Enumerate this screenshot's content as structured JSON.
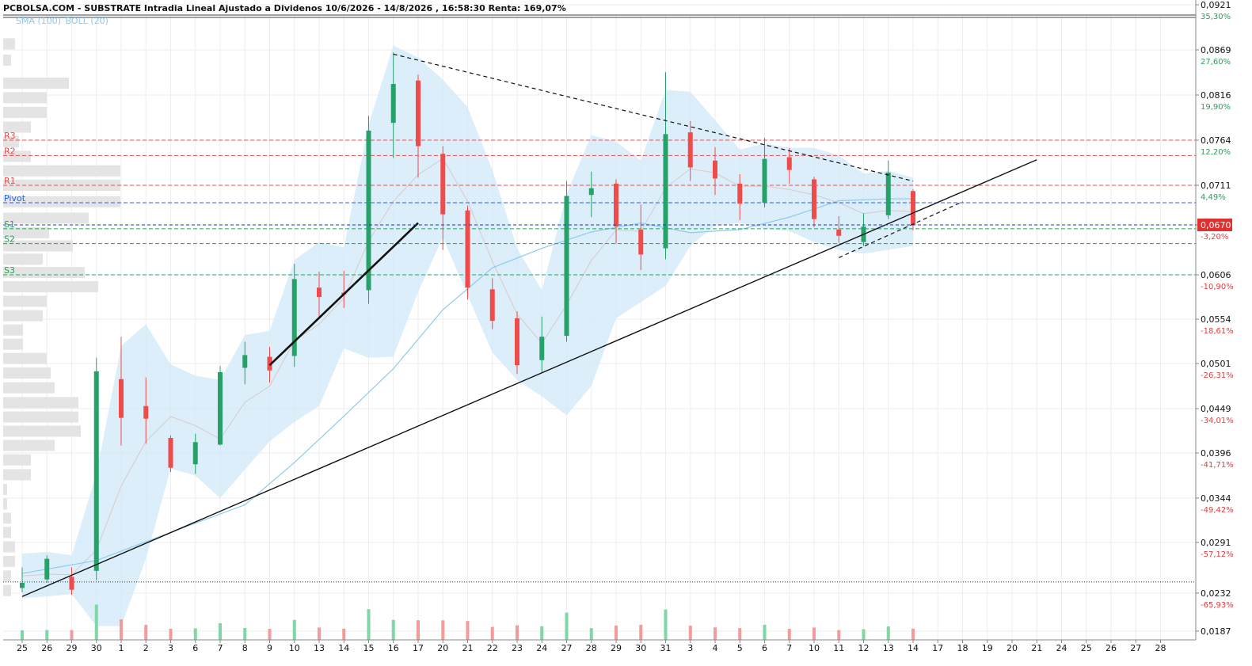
{
  "header": {
    "title": "PCBOLSA.COM - SUBSTRATE Intradia Lineal Ajustado a Dividenos 10/6/2026 - 14/8/2026 , 16:58:30 Renta: 169,07%",
    "indicators": [
      "SMA (100)",
      "BOLL (20)"
    ]
  },
  "chart_data": {
    "type": "candlestick",
    "title": "PCBOLSA.COM - SUBSTRATE Intradia Lineal Ajustado a Dividenos 10/6/2026 - 14/8/2026 , 16:58:30 Renta: 169,07%",
    "x_tick_labels": [
      "25",
      "26",
      "29",
      "30",
      "1",
      "2",
      "3",
      "6",
      "7",
      "8",
      "9",
      "10",
      "13",
      "14",
      "15",
      "16",
      "17",
      "20",
      "21",
      "22",
      "23",
      "24",
      "27",
      "28",
      "29",
      "30",
      "31",
      "3",
      "4",
      "5",
      "6",
      "7",
      "10",
      "11",
      "12",
      "13",
      "14",
      "17",
      "18",
      "19",
      "20",
      "21",
      "24",
      "25",
      "26",
      "27",
      "28"
    ],
    "y_axis": {
      "position": "right",
      "range": [
        0.0187,
        0.0921
      ],
      "ticks": [
        {
          "price": "0,0921",
          "pct": "35,30%",
          "pct_color": "#2e9e5b"
        },
        {
          "price": "0,0869",
          "pct": "27,60%",
          "pct_color": "#2e9e5b"
        },
        {
          "price": "0,0816",
          "pct": "19,90%",
          "pct_color": "#2e9e5b"
        },
        {
          "price": "0,0764",
          "pct": "12,20%",
          "pct_color": "#2e9e5b"
        },
        {
          "price": "0,0711",
          "pct": "4,49%",
          "pct_color": "#2e9e5b"
        },
        {
          "price": "0,0670",
          "pct": "-3,20%",
          "pct_color": "#e04040"
        },
        {
          "price": "0,0606",
          "pct": "-10,90%",
          "pct_color": "#e04040"
        },
        {
          "price": "0,0554",
          "pct": "-18,61%",
          "pct_color": "#e04040"
        },
        {
          "price": "0,0501",
          "pct": "-26,31%",
          "pct_color": "#e04040"
        },
        {
          "price": "0,0449",
          "pct": "-34,01%",
          "pct_color": "#e04040"
        },
        {
          "price": "0,0396",
          "pct": "-41,71%",
          "pct_color": "#e04040"
        },
        {
          "price": "0,0344",
          "pct": "-49,42%",
          "pct_color": "#e04040"
        },
        {
          "price": "0,0291",
          "pct": "-57,12%",
          "pct_color": "#e04040"
        },
        {
          "price": "0,0232",
          "pct": "-65,93%",
          "pct_color": "#e04040"
        },
        {
          "price": "0,0187",
          "pct": "",
          "pct_color": "#e04040"
        }
      ]
    },
    "last_price": {
      "label": "0,0670",
      "value": 0.067,
      "color": "#e03030"
    },
    "pivot_levels": [
      {
        "name": "R3",
        "value": 0.0764,
        "color": "#e05050",
        "style": "dashed"
      },
      {
        "name": "R2",
        "value": 0.0746,
        "color": "#e05050",
        "style": "dashed"
      },
      {
        "name": "R1",
        "value": 0.0711,
        "color": "#e05050",
        "style": "dashed"
      },
      {
        "name": "Pivot",
        "value": 0.0693,
        "color": "#3060d0",
        "style": "dashed"
      },
      {
        "name": "S1",
        "value": 0.0665,
        "color": "#2e9e5b",
        "style": "dashed"
      },
      {
        "name": "S2",
        "value": 0.0646,
        "color": "#2e9e5b",
        "style": "dashed"
      },
      {
        "name": "S3",
        "value": 0.0606,
        "color": "#2e9e5b",
        "style": "dashed"
      }
    ],
    "reference_line": {
      "value": 0.0245,
      "style": "dotted",
      "color": "#333333"
    },
    "grid": true,
    "colors": {
      "up": "#26a269",
      "down": "#f04b4b",
      "bollinger_fill": "#cfe8f8",
      "sma": "#8ccbee",
      "volume_up": "#7fd6a6",
      "volume_down": "#f59a9a"
    },
    "sessions": [
      {
        "date": "25",
        "open": 0.0238,
        "close": 0.0244,
        "high": 0.0262,
        "low": 0.0233
      },
      {
        "date": "26",
        "open": 0.0248,
        "close": 0.0272,
        "high": 0.0276,
        "low": 0.0244
      },
      {
        "date": "29",
        "open": 0.0251,
        "close": 0.0236,
        "high": 0.0262,
        "low": 0.023
      },
      {
        "date": "30",
        "open": 0.0258,
        "close": 0.0492,
        "high": 0.0508,
        "low": 0.0247
      },
      {
        "date": "1",
        "open": 0.0483,
        "close": 0.0438,
        "high": 0.0533,
        "low": 0.0405
      },
      {
        "date": "2",
        "open": 0.0452,
        "close": 0.0437,
        "high": 0.0485,
        "low": 0.0407
      },
      {
        "date": "3",
        "open": 0.0414,
        "close": 0.0379,
        "high": 0.0417,
        "low": 0.0374
      },
      {
        "date": "6",
        "open": 0.0383,
        "close": 0.0409,
        "high": 0.0419,
        "low": 0.0372
      },
      {
        "date": "7",
        "open": 0.0406,
        "close": 0.0491,
        "high": 0.0498,
        "low": 0.0405
      },
      {
        "date": "8",
        "open": 0.0496,
        "close": 0.0511,
        "high": 0.0527,
        "low": 0.0477
      },
      {
        "date": "9",
        "open": 0.0509,
        "close": 0.0493,
        "high": 0.0521,
        "low": 0.0479
      },
      {
        "date": "10",
        "open": 0.051,
        "close": 0.0601,
        "high": 0.062,
        "low": 0.0497
      },
      {
        "date": "13",
        "open": 0.0591,
        "close": 0.058,
        "high": 0.061,
        "low": 0.0556
      },
      {
        "date": "14",
        "open": 0.0585,
        "close": 0.0583,
        "high": 0.0611,
        "low": 0.0567
      },
      {
        "date": "15",
        "open": 0.0588,
        "close": 0.0775,
        "high": 0.0792,
        "low": 0.0572
      },
      {
        "date": "16",
        "open": 0.0784,
        "close": 0.0829,
        "high": 0.0866,
        "low": 0.0743
      },
      {
        "date": "17",
        "open": 0.0833,
        "close": 0.0757,
        "high": 0.084,
        "low": 0.072
      },
      {
        "date": "20",
        "open": 0.0748,
        "close": 0.0681,
        "high": 0.0757,
        "low": 0.0638
      },
      {
        "date": "21",
        "open": 0.0685,
        "close": 0.0591,
        "high": 0.069,
        "low": 0.0577
      },
      {
        "date": "22",
        "open": 0.0589,
        "close": 0.0552,
        "high": 0.0602,
        "low": 0.0542
      },
      {
        "date": "23",
        "open": 0.0555,
        "close": 0.0499,
        "high": 0.0563,
        "low": 0.0489
      },
      {
        "date": "24",
        "open": 0.0505,
        "close": 0.0533,
        "high": 0.0557,
        "low": 0.0491
      },
      {
        "date": "27",
        "open": 0.0534,
        "close": 0.07,
        "high": 0.0716,
        "low": 0.0527
      },
      {
        "date": "28",
        "open": 0.0701,
        "close": 0.0708,
        "high": 0.0727,
        "low": 0.0678
      },
      {
        "date": "29",
        "open": 0.0713,
        "close": 0.0668,
        "high": 0.0718,
        "low": 0.0646
      },
      {
        "date": "30",
        "open": 0.0664,
        "close": 0.0632,
        "high": 0.0691,
        "low": 0.0612
      },
      {
        "date": "31",
        "open": 0.064,
        "close": 0.0771,
        "high": 0.0843,
        "low": 0.0626
      },
      {
        "date": "3",
        "open": 0.0773,
        "close": 0.0732,
        "high": 0.0786,
        "low": 0.0716
      },
      {
        "date": "4",
        "open": 0.074,
        "close": 0.0719,
        "high": 0.0756,
        "low": 0.0701
      },
      {
        "date": "5",
        "open": 0.0713,
        "close": 0.0692,
        "high": 0.0724,
        "low": 0.0675
      },
      {
        "date": "6",
        "open": 0.0693,
        "close": 0.0742,
        "high": 0.0767,
        "low": 0.0688
      },
      {
        "date": "7",
        "open": 0.0744,
        "close": 0.0729,
        "high": 0.0755,
        "low": 0.0713
      },
      {
        "date": "10",
        "open": 0.0718,
        "close": 0.0676,
        "high": 0.0721,
        "low": 0.0667
      },
      {
        "date": "11",
        "open": 0.0664,
        "close": 0.0656,
        "high": 0.0679,
        "low": 0.0647
      },
      {
        "date": "12",
        "open": 0.0648,
        "close": 0.0668,
        "high": 0.0682,
        "low": 0.0643
      },
      {
        "date": "13",
        "open": 0.068,
        "close": 0.0726,
        "high": 0.074,
        "low": 0.0676
      },
      {
        "date": "14",
        "open": 0.0705,
        "close": 0.067,
        "high": 0.0707,
        "low": 0.0663
      }
    ],
    "bollinger": [
      {
        "date": "25",
        "upper": 0.0278,
        "lower": 0.0226
      },
      {
        "date": "26",
        "upper": 0.028,
        "lower": 0.0228
      },
      {
        "date": "29",
        "upper": 0.0276,
        "lower": 0.0231
      },
      {
        "date": "30",
        "upper": 0.0372,
        "lower": 0.0193
      },
      {
        "date": "1",
        "upper": 0.0522,
        "lower": 0.0193
      },
      {
        "date": "2",
        "upper": 0.0548,
        "lower": 0.0272
      },
      {
        "date": "3",
        "upper": 0.05,
        "lower": 0.0378
      },
      {
        "date": "6",
        "upper": 0.0487,
        "lower": 0.037
      },
      {
        "date": "7",
        "upper": 0.0482,
        "lower": 0.0344
      },
      {
        "date": "8",
        "upper": 0.0535,
        "lower": 0.0377
      },
      {
        "date": "9",
        "upper": 0.054,
        "lower": 0.041
      },
      {
        "date": "10",
        "upper": 0.0625,
        "lower": 0.0433
      },
      {
        "date": "13",
        "upper": 0.0648,
        "lower": 0.0452
      },
      {
        "date": "14",
        "upper": 0.0641,
        "lower": 0.0519
      },
      {
        "date": "15",
        "upper": 0.0782,
        "lower": 0.0508
      },
      {
        "date": "16",
        "upper": 0.0874,
        "lower": 0.0509
      },
      {
        "date": "17",
        "upper": 0.086,
        "lower": 0.0586
      },
      {
        "date": "20",
        "upper": 0.0834,
        "lower": 0.0654
      },
      {
        "date": "21",
        "upper": 0.0802,
        "lower": 0.0582
      },
      {
        "date": "22",
        "upper": 0.0729,
        "lower": 0.0514
      },
      {
        "date": "23",
        "upper": 0.064,
        "lower": 0.0482
      },
      {
        "date": "24",
        "upper": 0.0588,
        "lower": 0.0463
      },
      {
        "date": "27",
        "upper": 0.0702,
        "lower": 0.0441
      },
      {
        "date": "28",
        "upper": 0.077,
        "lower": 0.0475
      },
      {
        "date": "29",
        "upper": 0.0762,
        "lower": 0.0555
      },
      {
        "date": "30",
        "upper": 0.074,
        "lower": 0.0574
      },
      {
        "date": "31",
        "upper": 0.0822,
        "lower": 0.0593
      },
      {
        "date": "3",
        "upper": 0.082,
        "lower": 0.0643
      },
      {
        "date": "4",
        "upper": 0.0787,
        "lower": 0.0669
      },
      {
        "date": "5",
        "upper": 0.0753,
        "lower": 0.0672
      },
      {
        "date": "6",
        "upper": 0.076,
        "lower": 0.0665
      },
      {
        "date": "7",
        "upper": 0.0755,
        "lower": 0.0662
      },
      {
        "date": "10",
        "upper": 0.0755,
        "lower": 0.0648
      },
      {
        "date": "11",
        "upper": 0.0746,
        "lower": 0.0638
      },
      {
        "date": "12",
        "upper": 0.0725,
        "lower": 0.0633
      },
      {
        "date": "13",
        "upper": 0.0728,
        "lower": 0.0638
      },
      {
        "date": "14",
        "upper": 0.072,
        "lower": 0.0643
      }
    ],
    "sma_100": [
      {
        "date": "25",
        "value": 0.0255
      },
      {
        "date": "30",
        "value": 0.027
      },
      {
        "date": "3",
        "value": 0.0303
      },
      {
        "date": "8",
        "value": 0.0336
      },
      {
        "date": "10",
        "value": 0.0385
      },
      {
        "date": "14",
        "value": 0.044
      },
      {
        "date": "16",
        "value": 0.0495
      },
      {
        "date": "20",
        "value": 0.0565
      },
      {
        "date": "22",
        "value": 0.0615
      },
      {
        "date": "24",
        "value": 0.064
      },
      {
        "date": "28",
        "value": 0.0661
      },
      {
        "date": "30",
        "value": 0.0672
      },
      {
        "date": "3",
        "value": 0.066
      },
      {
        "date": "5",
        "value": 0.0664
      },
      {
        "date": "7",
        "value": 0.0678
      },
      {
        "date": "11",
        "value": 0.0695
      },
      {
        "date": "13",
        "value": 0.0697
      },
      {
        "date": "14",
        "value": 0.0697
      }
    ],
    "trendlines": [
      {
        "name": "long support",
        "x1": "25",
        "y1": 0.0228,
        "x2": "21",
        "y2": 0.0741,
        "style": "solid"
      },
      {
        "name": "bold support",
        "x1": "9",
        "y1": 0.0499,
        "x2": "17",
        "y2": 0.0672,
        "style": "solid-bold"
      },
      {
        "name": "resistance",
        "x1": "16",
        "y1": 0.0864,
        "x2": "14",
        "y2": 0.0716,
        "style": "dashed"
      },
      {
        "name": "channel",
        "x1": "11",
        "y1": 0.0628,
        "x2": "18",
        "y2": 0.0694,
        "style": "dashed"
      }
    ],
    "volume_profile": [
      {
        "price": 0.0876,
        "width": 0.15
      },
      {
        "price": 0.0857,
        "width": 0.1
      },
      {
        "price": 0.083,
        "width": 0.83
      },
      {
        "price": 0.0813,
        "width": 0.55
      },
      {
        "price": 0.0796,
        "width": 0.55
      },
      {
        "price": 0.0779,
        "width": 0.35
      },
      {
        "price": 0.0762,
        "width": 0.2
      },
      {
        "price": 0.0745,
        "width": 0.35
      },
      {
        "price": 0.0728,
        "width": 1.48
      },
      {
        "price": 0.0711,
        "width": 1.48
      },
      {
        "price": 0.0694,
        "width": 1.48
      },
      {
        "price": 0.0677,
        "width": 1.08
      },
      {
        "price": 0.066,
        "width": 0.58
      },
      {
        "price": 0.0643,
        "width": 0.88
      },
      {
        "price": 0.0626,
        "width": 0.5
      },
      {
        "price": 0.0609,
        "width": 1.03
      },
      {
        "price": 0.0592,
        "width": 1.2
      },
      {
        "price": 0.0575,
        "width": 0.55
      },
      {
        "price": 0.0558,
        "width": 0.5
      },
      {
        "price": 0.0541,
        "width": 0.25
      },
      {
        "price": 0.0524,
        "width": 0.25
      },
      {
        "price": 0.0507,
        "width": 0.55
      },
      {
        "price": 0.049,
        "width": 0.6
      },
      {
        "price": 0.0473,
        "width": 0.65
      },
      {
        "price": 0.0456,
        "width": 0.95
      },
      {
        "price": 0.0439,
        "width": 0.95
      },
      {
        "price": 0.0422,
        "width": 0.98
      },
      {
        "price": 0.0405,
        "width": 0.65
      },
      {
        "price": 0.0388,
        "width": 0.35
      },
      {
        "price": 0.0371,
        "width": 0.35
      },
      {
        "price": 0.0354,
        "width": 0.05
      },
      {
        "price": 0.0337,
        "width": 0.05
      },
      {
        "price": 0.032,
        "width": 0.1
      },
      {
        "price": 0.0303,
        "width": 0.1
      },
      {
        "price": 0.0286,
        "width": 0.15
      },
      {
        "price": 0.0269,
        "width": 0.15
      },
      {
        "price": 0.0252,
        "width": 0.1
      },
      {
        "price": 0.0235,
        "width": 0.1
      }
    ]
  }
}
